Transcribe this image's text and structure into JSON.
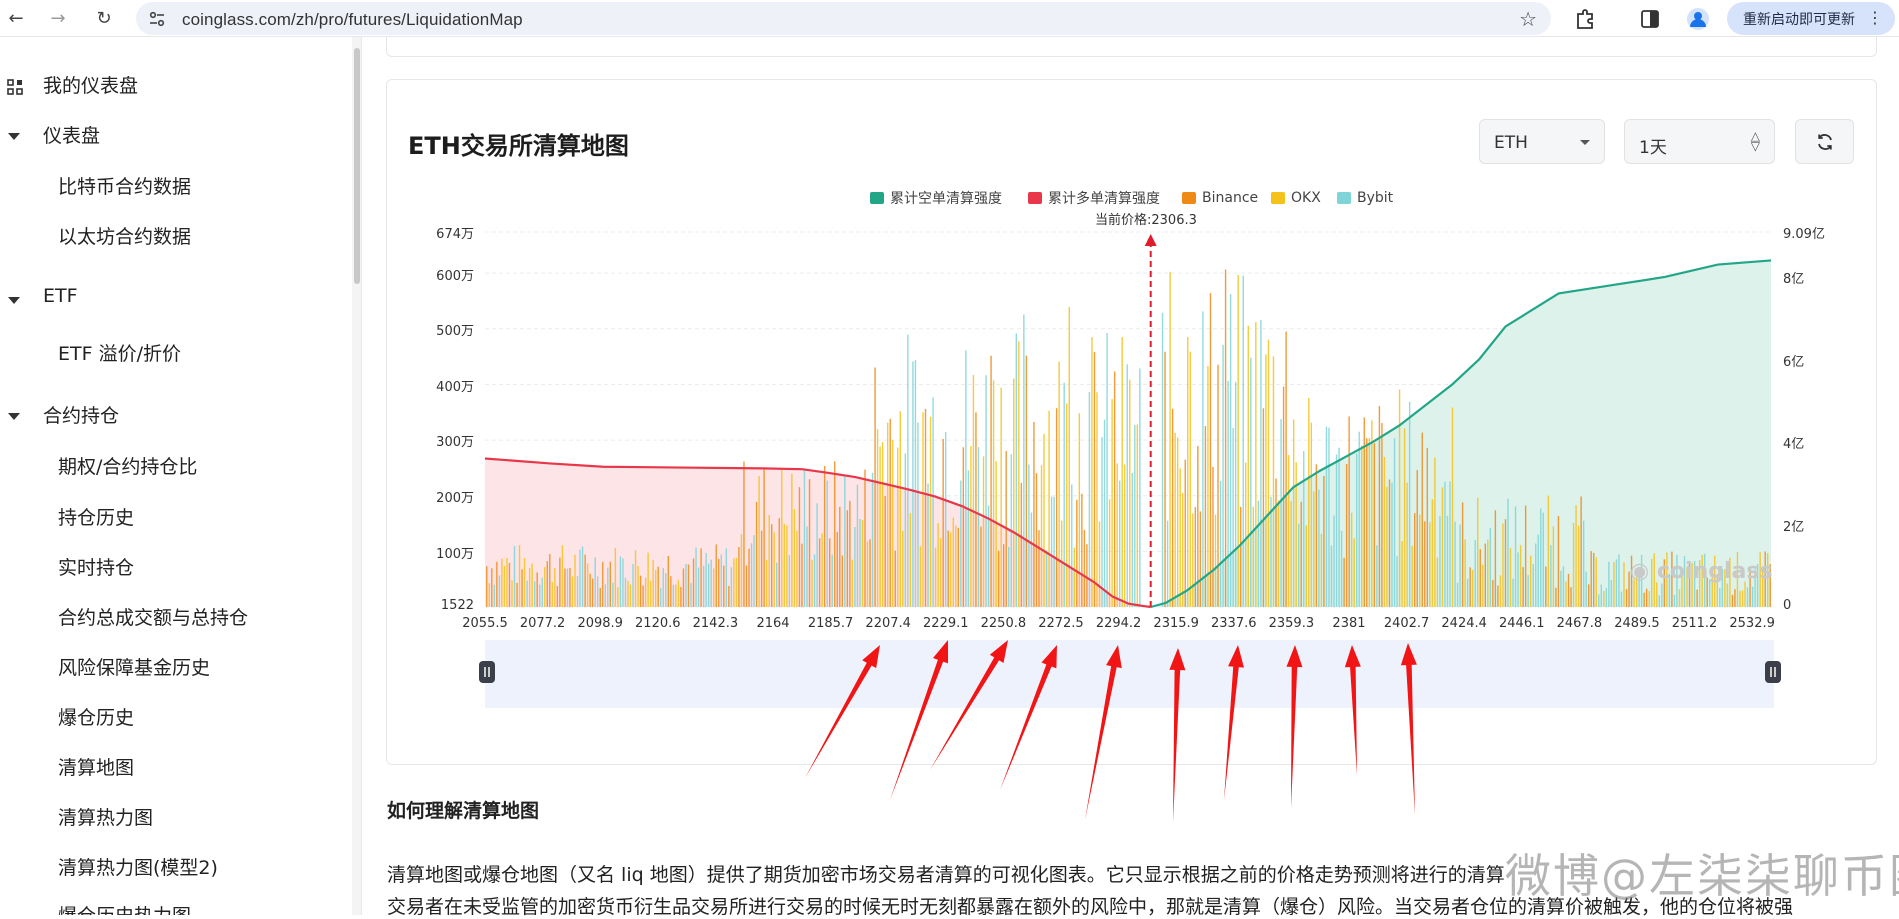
{
  "browser": {
    "url": "coinglass.com/zh/pro/futures/LiquidationMap",
    "relaunch_label": "重新启动即可更新"
  },
  "sidebar": {
    "items": [
      {
        "label": "我的仪表盘",
        "type": "top"
      },
      {
        "label": "仪表盘",
        "type": "group"
      },
      {
        "label": "比特币合约数据",
        "type": "sub"
      },
      {
        "label": "以太坊合约数据",
        "type": "sub"
      },
      {
        "label": "ETF",
        "type": "group"
      },
      {
        "label": "ETF 溢价/折价",
        "type": "sub"
      },
      {
        "label": "合约持仓",
        "type": "group"
      },
      {
        "label": "期权/合约持仓比",
        "type": "sub"
      },
      {
        "label": "持仓历史",
        "type": "sub"
      },
      {
        "label": "实时持仓",
        "type": "sub"
      },
      {
        "label": "合约总成交额与总持仓",
        "type": "sub"
      },
      {
        "label": "风险保障基金历史",
        "type": "sub"
      },
      {
        "label": "爆仓历史",
        "type": "sub"
      },
      {
        "label": "清算地图",
        "type": "sub"
      },
      {
        "label": "清算热力图",
        "type": "sub"
      },
      {
        "label": "清算热力图(模型2)",
        "type": "sub"
      },
      {
        "label": "爆仓历史热力图",
        "type": "sub"
      }
    ]
  },
  "main": {
    "title": "ETH交易所清算地图",
    "coin_select": "ETH",
    "period_select": "1天",
    "section_heading": "如何理解清算地图",
    "paragraph_1": "清算地图或爆仓地图（又名 liq 地图）提供了期货加密市场交易者清算的可视化图表。它只显示根据之前的价格走势预测将进行的清算",
    "paragraph_2": "交易者在未受监管的加密货币衍生品交易所进行交易的时候无时无刻都暴露在额外的风险中，那就是清算（爆仓）风险。当交易者仓位的清算价被触发，他的仓位将被强",
    "watermark": "微博@左柒柒聊币圈"
  },
  "chart_data": {
    "type": "bar",
    "legend": [
      {
        "name": "累计空单清算强度",
        "color": "#22a687"
      },
      {
        "name": "累计多单清算强度",
        "color": "#e8364a"
      },
      {
        "name": "Binance",
        "color": "#f08a17"
      },
      {
        "name": "OKX",
        "color": "#f4c21a"
      },
      {
        "name": "Bybit",
        "color": "#7fd4d8"
      }
    ],
    "current_price_label": "当前价格:2306.3",
    "current_price": 2306.3,
    "left_axis_ticks": [
      "674万",
      "600万",
      "500万",
      "400万",
      "300万",
      "200万",
      "100万",
      "1522"
    ],
    "right_axis_ticks": [
      "9.09亿",
      "8亿",
      "6亿",
      "4亿",
      "2亿",
      "0"
    ],
    "x_ticks": [
      "2055.5",
      "2077.2",
      "2098.9",
      "2120.6",
      "2142.3",
      "2164",
      "2185.7",
      "2207.4",
      "2229.1",
      "2250.8",
      "2272.5",
      "2294.2",
      "2315.9",
      "2337.6",
      "2359.3",
      "2381",
      "2402.7",
      "2424.4",
      "2446.1",
      "2467.8",
      "2489.5",
      "2511.2",
      "2532.9"
    ],
    "xlim": [
      2055.5,
      2540
    ],
    "ylim_left": [
      0,
      6740000
    ],
    "ylim_right": [
      0,
      909000000
    ],
    "cumulative_long": [
      [
        2055.5,
        360000000
      ],
      [
        2080,
        348000000
      ],
      [
        2100,
        340000000
      ],
      [
        2130,
        338000000
      ],
      [
        2160,
        336000000
      ],
      [
        2175,
        334000000
      ],
      [
        2185,
        325000000
      ],
      [
        2195,
        315000000
      ],
      [
        2205,
        300000000
      ],
      [
        2215,
        285000000
      ],
      [
        2225,
        268000000
      ],
      [
        2235,
        245000000
      ],
      [
        2245,
        215000000
      ],
      [
        2255,
        180000000
      ],
      [
        2265,
        140000000
      ],
      [
        2275,
        100000000
      ],
      [
        2285,
        60000000
      ],
      [
        2292,
        25000000
      ],
      [
        2298,
        8000000
      ],
      [
        2304,
        2000000
      ],
      [
        2306.3,
        0
      ]
    ],
    "cumulative_short": [
      [
        2306.3,
        0
      ],
      [
        2312,
        10000000
      ],
      [
        2320,
        40000000
      ],
      [
        2330,
        90000000
      ],
      [
        2340,
        150000000
      ],
      [
        2350,
        220000000
      ],
      [
        2360,
        290000000
      ],
      [
        2370,
        330000000
      ],
      [
        2380,
        365000000
      ],
      [
        2390,
        400000000
      ],
      [
        2400,
        440000000
      ],
      [
        2410,
        490000000
      ],
      [
        2420,
        540000000
      ],
      [
        2430,
        600000000
      ],
      [
        2440,
        680000000
      ],
      [
        2450,
        720000000
      ],
      [
        2460,
        760000000
      ],
      [
        2480,
        780000000
      ],
      [
        2500,
        800000000
      ],
      [
        2520,
        830000000
      ],
      [
        2540,
        840000000
      ]
    ],
    "logo_text": "coinglass"
  }
}
